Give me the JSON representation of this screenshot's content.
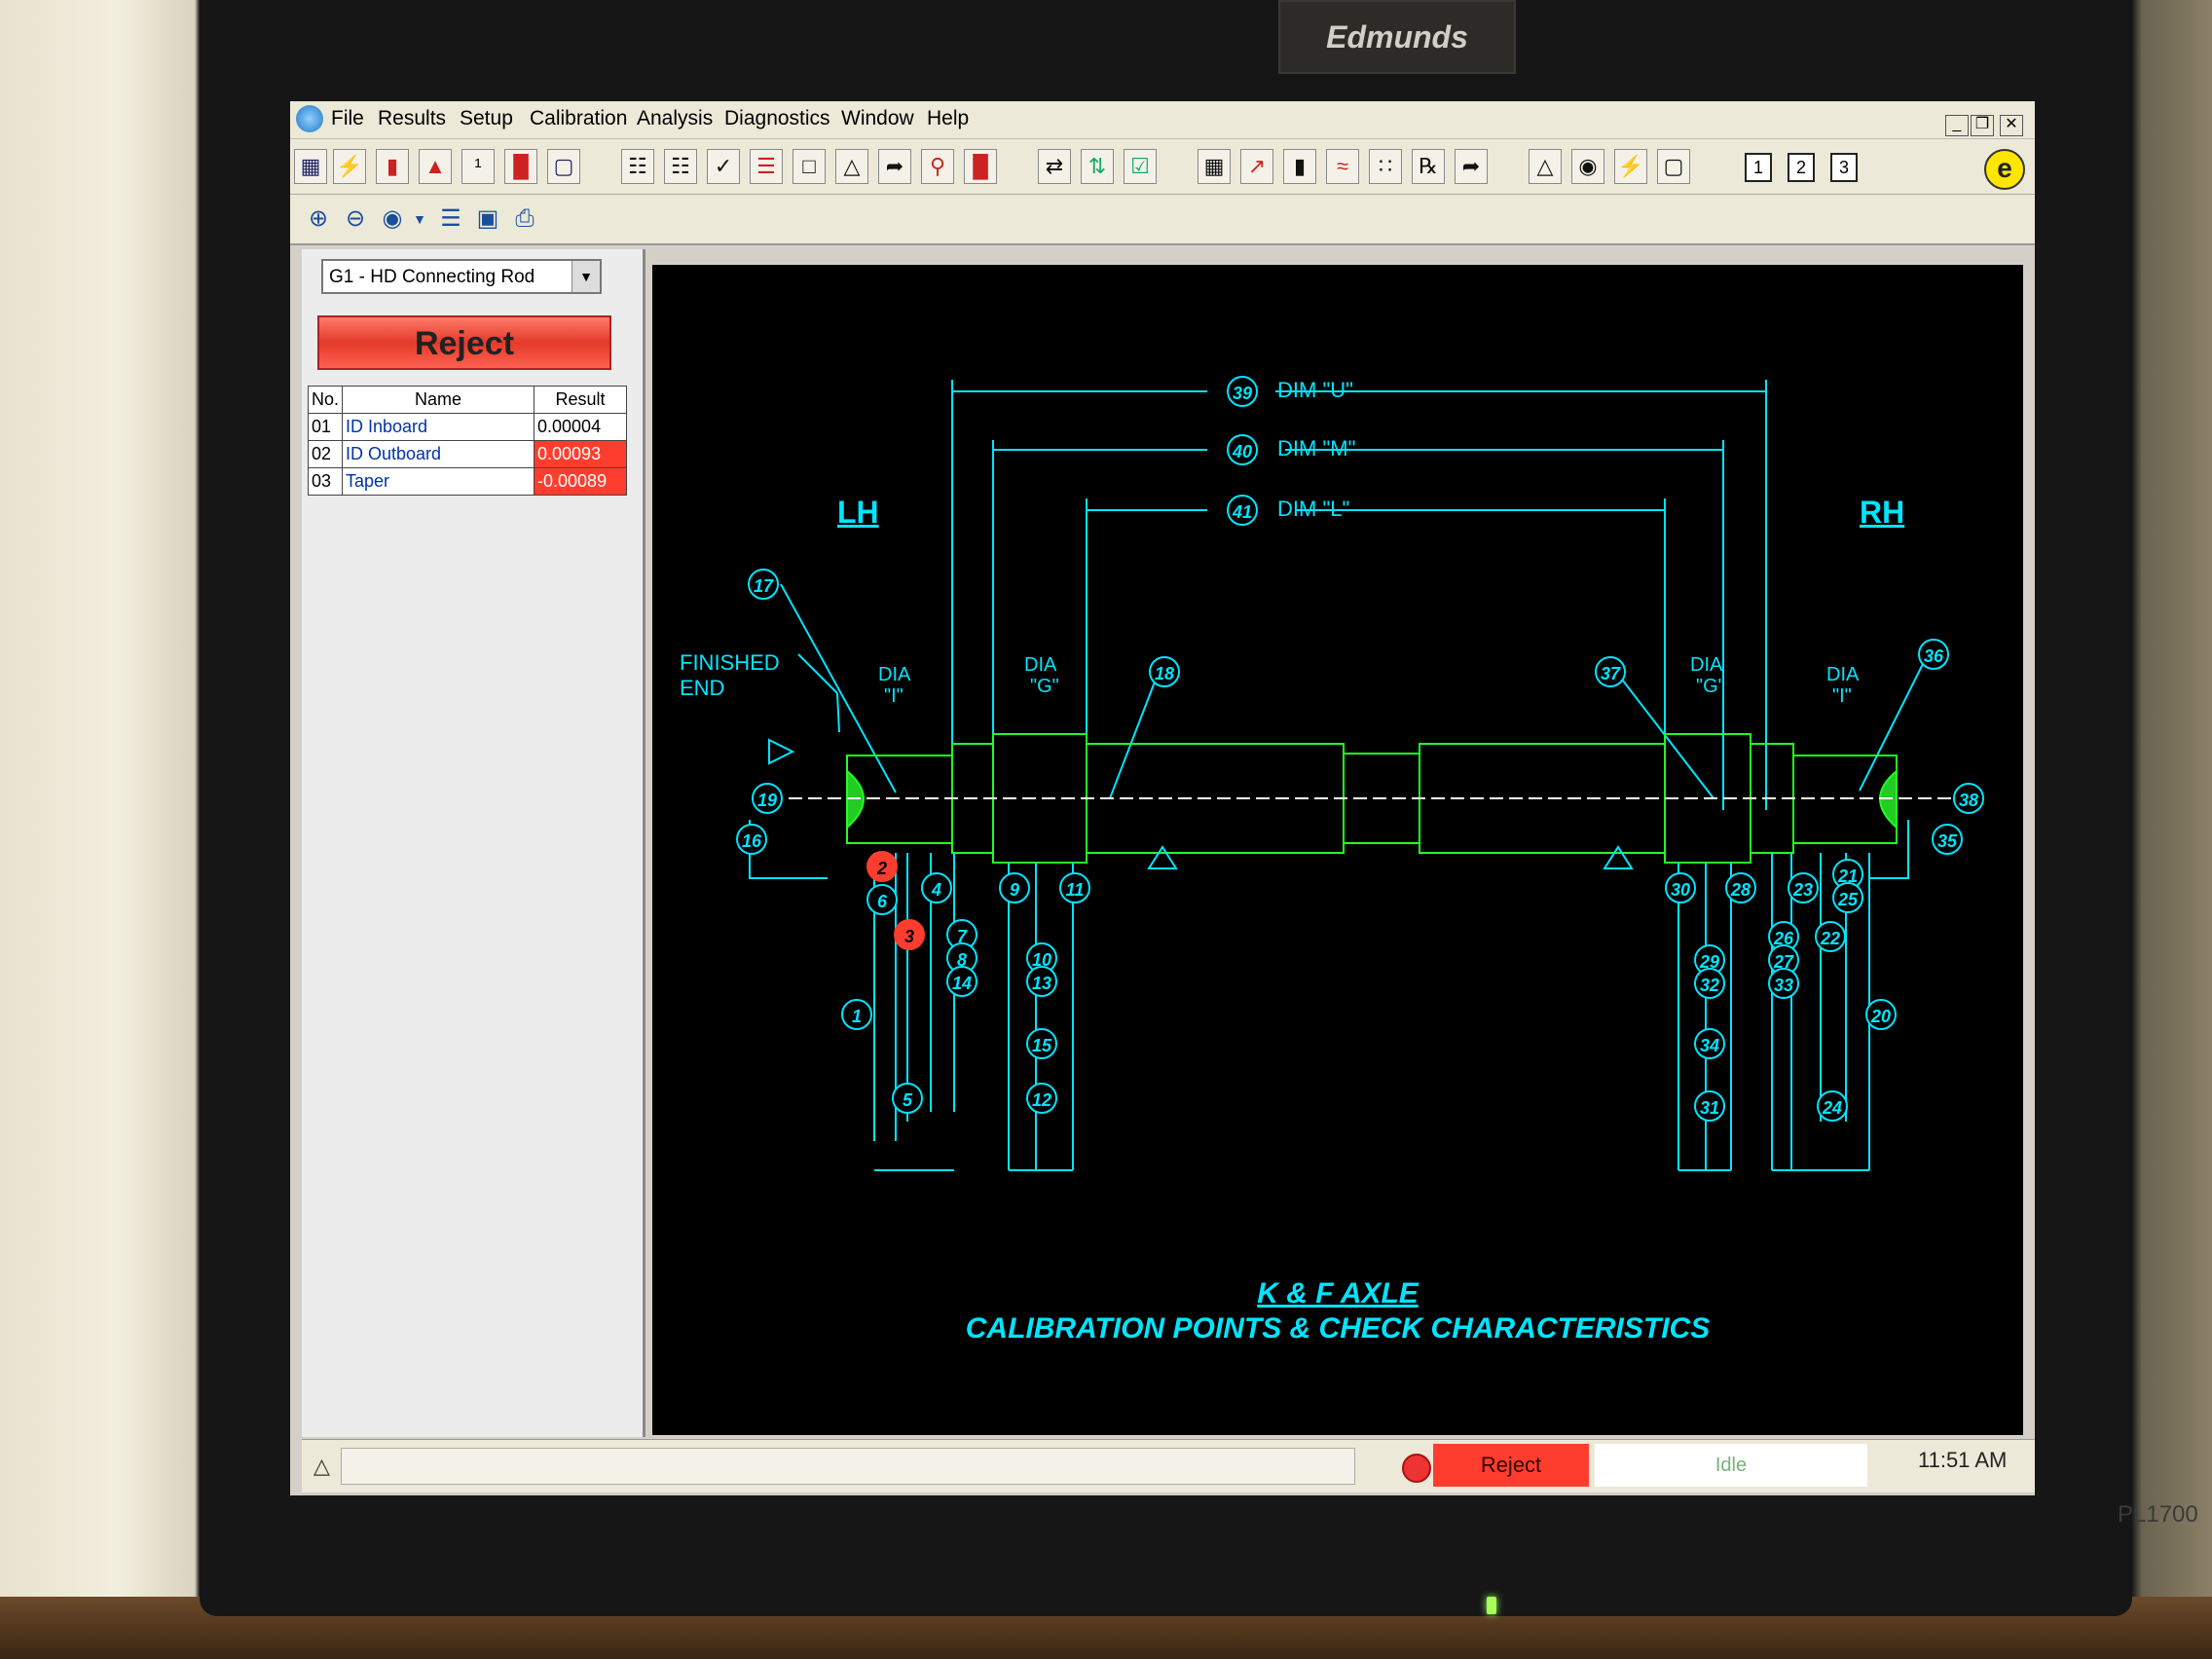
{
  "monitor": {
    "brand": "Edmunds",
    "model": "PL1700"
  },
  "menu": [
    "File",
    "Results",
    "Setup",
    "Calibration",
    "Analysis",
    "Diagnostics",
    "Window",
    "Help"
  ],
  "window_controls": [
    "_",
    "❐",
    "✕"
  ],
  "toolbar": {
    "window_buttons": [
      "1",
      "2",
      "3"
    ]
  },
  "left_panel": {
    "gage_select": "G1 - HD Connecting Rod",
    "status": "Reject",
    "table": {
      "headers": [
        "No.",
        "Name",
        "Result"
      ],
      "rows": [
        {
          "no": "01",
          "name": "ID Inboard",
          "result": "0.00004",
          "status": "ok"
        },
        {
          "no": "02",
          "name": "ID Outboard",
          "result": "0.00093",
          "status": "reject"
        },
        {
          "no": "03",
          "name": "Taper",
          "result": "-0.00089",
          "status": "reject"
        }
      ]
    }
  },
  "drawing": {
    "title": "K & F AXLE",
    "subtitle": "CALIBRATION POINTS & CHECK CHARACTERISTICS",
    "lh": "LH",
    "rh": "RH",
    "dims": [
      {
        "num": "39",
        "label": "DIM \"U\""
      },
      {
        "num": "40",
        "label": "DIM \"M\""
      },
      {
        "num": "41",
        "label": "DIM \"L\""
      }
    ],
    "finished_end": [
      "FINISHED",
      "END"
    ],
    "dia_labels": [
      {
        "line1": "DIA",
        "line2": "\"I\""
      },
      {
        "line1": "DIA",
        "line2": "\"G\""
      },
      {
        "line1": "DIA",
        "line2": "\"G\""
      },
      {
        "line1": "DIA",
        "line2": "\"I\""
      }
    ],
    "callouts": [
      "17",
      "18",
      "19",
      "16",
      "2",
      "6",
      "3",
      "4",
      "7",
      "8",
      "14",
      "1",
      "5",
      "15",
      "9",
      "10",
      "13",
      "11",
      "12",
      "37",
      "36",
      "38",
      "35",
      "30",
      "28",
      "23",
      "21",
      "25",
      "26",
      "27",
      "22",
      "29",
      "32",
      "33",
      "34",
      "20",
      "31",
      "24"
    ],
    "reject_callouts": [
      "2",
      "3"
    ]
  },
  "statusbar": {
    "status": "Reject",
    "state": "Idle",
    "time": "11:51 AM"
  },
  "colors": {
    "cyan": "#00e5ff",
    "green": "#22ff22",
    "reject": "#ff3d2e"
  }
}
